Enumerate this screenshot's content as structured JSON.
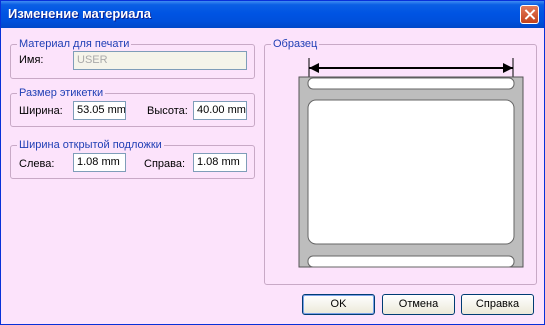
{
  "window": {
    "title": "Изменение материала"
  },
  "material": {
    "legend": "Материал для печати",
    "name_label": "Имя:",
    "name_value": "USER"
  },
  "label_size": {
    "legend": "Размер этикетки",
    "width_label": "Ширина:",
    "width_value": "53.05 mm",
    "height_label": "Высота:",
    "height_value": "40.00 mm"
  },
  "liner_width": {
    "legend": "Ширина открытой подложки",
    "left_label": "Слева:",
    "left_value": "1.08 mm",
    "right_label": "Справа:",
    "right_value": "1.08 mm"
  },
  "preview": {
    "legend": "Образец"
  },
  "buttons": {
    "ok": "OK",
    "cancel": "Отмена",
    "help": "Справка"
  },
  "colors": {
    "titlebar": "#0054e3",
    "dialog_bg": "#fce3fb",
    "legend_text": "#1f3fb5"
  }
}
